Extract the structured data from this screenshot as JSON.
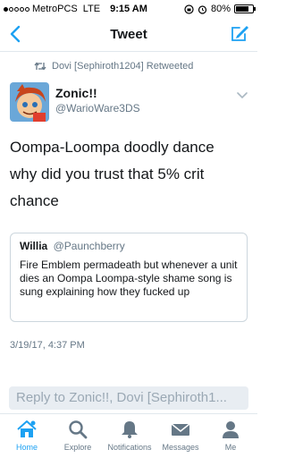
{
  "status_bar": {
    "carrier": "MetroPCS",
    "network": "LTE",
    "time": "9:15 AM",
    "battery": "80%",
    "battery_level": 0.8
  },
  "nav": {
    "title": "Tweet",
    "accent_color": "#1da1f2"
  },
  "retweet": {
    "text": "Dovi [Sephiroth1204] Retweeted"
  },
  "author": {
    "name": "Zonic!!",
    "handle": "@WarioWare3DS"
  },
  "tweet": {
    "line1": "Oompa-Loompa doodly dance",
    "line2": "why did you trust that 5% crit",
    "line3": "chance"
  },
  "quote": {
    "name": "Willia",
    "handle": "@Paunchberry",
    "text": "Fire Emblem permadeath but whenever a unit dies an Oompa Loompa-style shame song is sung explaining how they fucked up"
  },
  "timestamp": "3/19/17, 4:37 PM",
  "reply": {
    "placeholder": "Reply to Zonic!!, Dovi [Sephiroth1..."
  },
  "tabs": [
    {
      "label": "Home",
      "icon": "home-icon",
      "active": true
    },
    {
      "label": "Explore",
      "icon": "search-icon",
      "active": false
    },
    {
      "label": "Notifications",
      "icon": "bell-icon",
      "active": false
    },
    {
      "label": "Messages",
      "icon": "envelope-icon",
      "active": false
    },
    {
      "label": "Me",
      "icon": "person-icon",
      "active": false
    }
  ]
}
